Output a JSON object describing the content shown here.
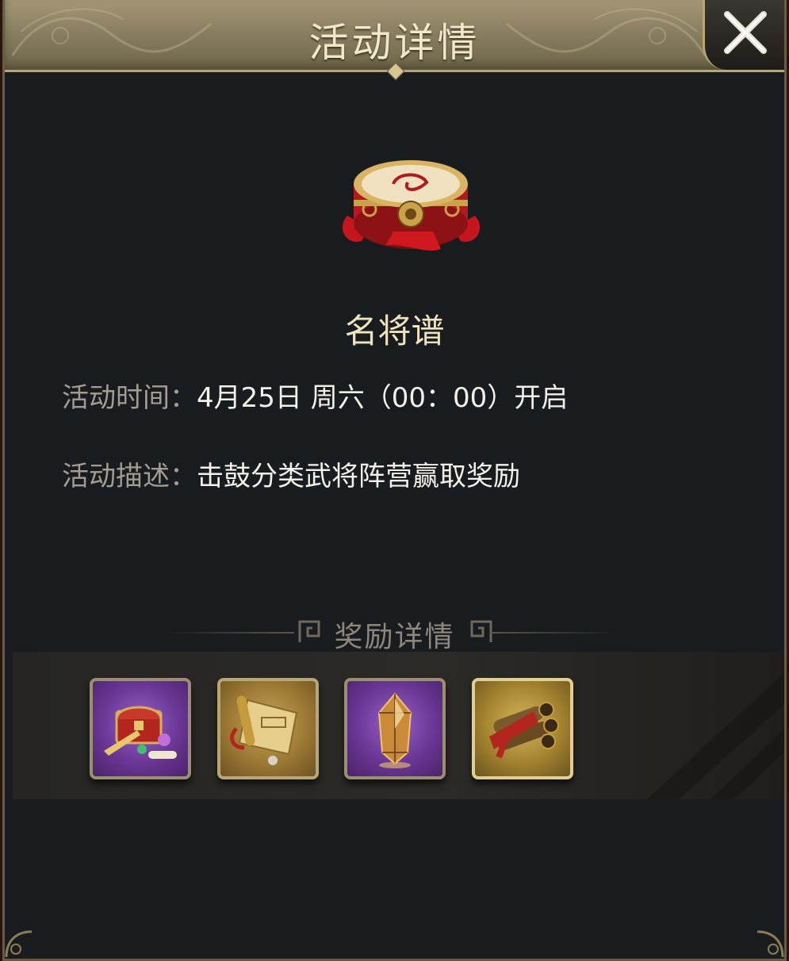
{
  "dialog": {
    "title": "活动详情",
    "close_icon": "close-x-icon"
  },
  "event": {
    "icon": "war-drum-icon",
    "name": "名将谱",
    "time_label": "活动时间：",
    "time_value": "4月25日  周六（00：00）开启",
    "desc_label": "活动描述：",
    "desc_value": "击鼓分类武将阵营赢取奖励"
  },
  "rewards": {
    "heading": "奖励详情",
    "items": [
      {
        "icon": "treasure-chest-icon",
        "frame": "purple"
      },
      {
        "icon": "scroll-icon",
        "frame": "gold"
      },
      {
        "icon": "crystal-icon",
        "frame": "purple"
      },
      {
        "icon": "war-manual-bundle-icon",
        "frame": "gold"
      }
    ]
  }
}
